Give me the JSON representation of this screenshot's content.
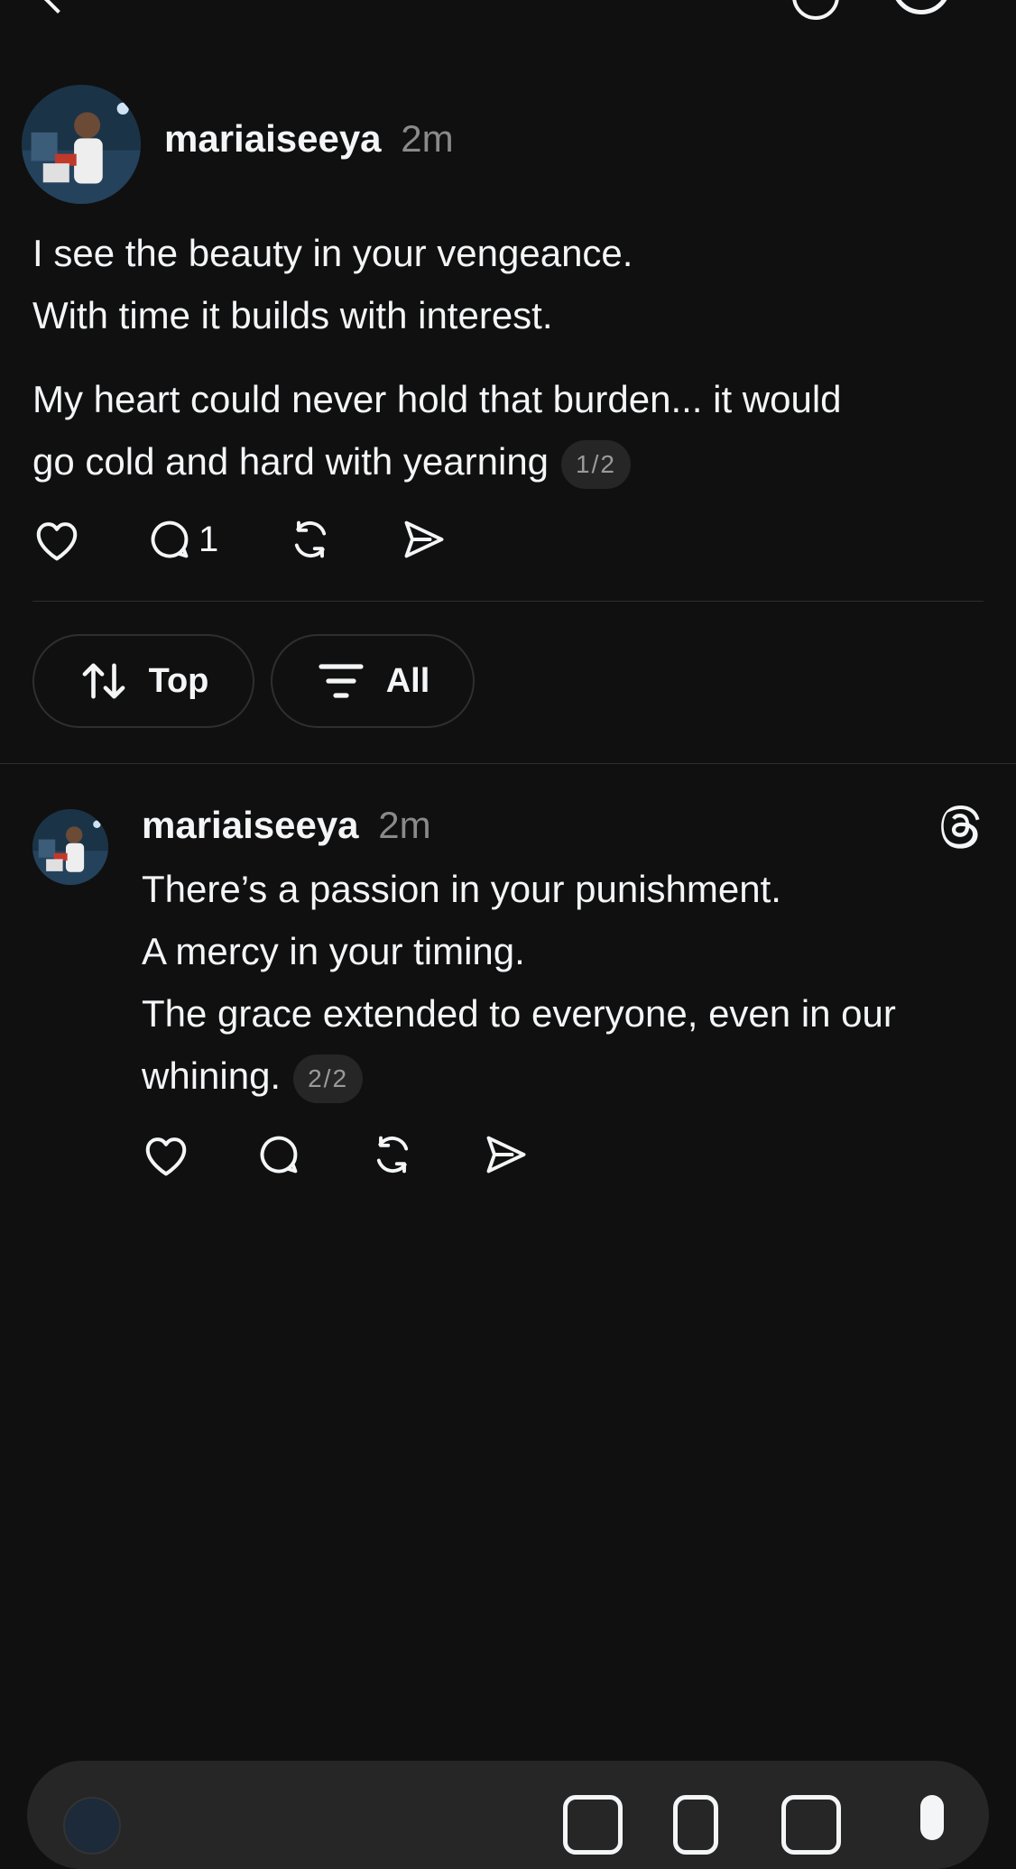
{
  "post": {
    "username": "mariaiseeya",
    "time": "2m",
    "lines_a": [
      "I see the beauty in your vengeance.",
      "With time it builds with interest."
    ],
    "lines_b": [
      "My heart could never hold that burden... it would",
      "go cold and hard with yearning"
    ],
    "counter": "1/2",
    "reply_count": "1"
  },
  "sort": {
    "top_label": "Top",
    "all_label": "All"
  },
  "reply": {
    "username": "mariaiseeya",
    "time": "2m",
    "lines": [
      "There’s a passion in your punishment.",
      "A mercy in your timing.",
      "The grace extended to everyone, even in our",
      "whining."
    ],
    "counter": "2/2"
  },
  "icons": {
    "like": "heart-icon",
    "comment": "comment-icon",
    "repost": "repost-icon",
    "share": "share-icon",
    "sort": "sort-arrows-icon",
    "filter": "filter-icon",
    "threads": "threads-logo-icon"
  },
  "colors": {
    "background": "#101010",
    "text": "#f3f5f7",
    "muted": "#8a8a8a",
    "pill_border": "#2f2f2f",
    "counter_bg": "#262626"
  }
}
